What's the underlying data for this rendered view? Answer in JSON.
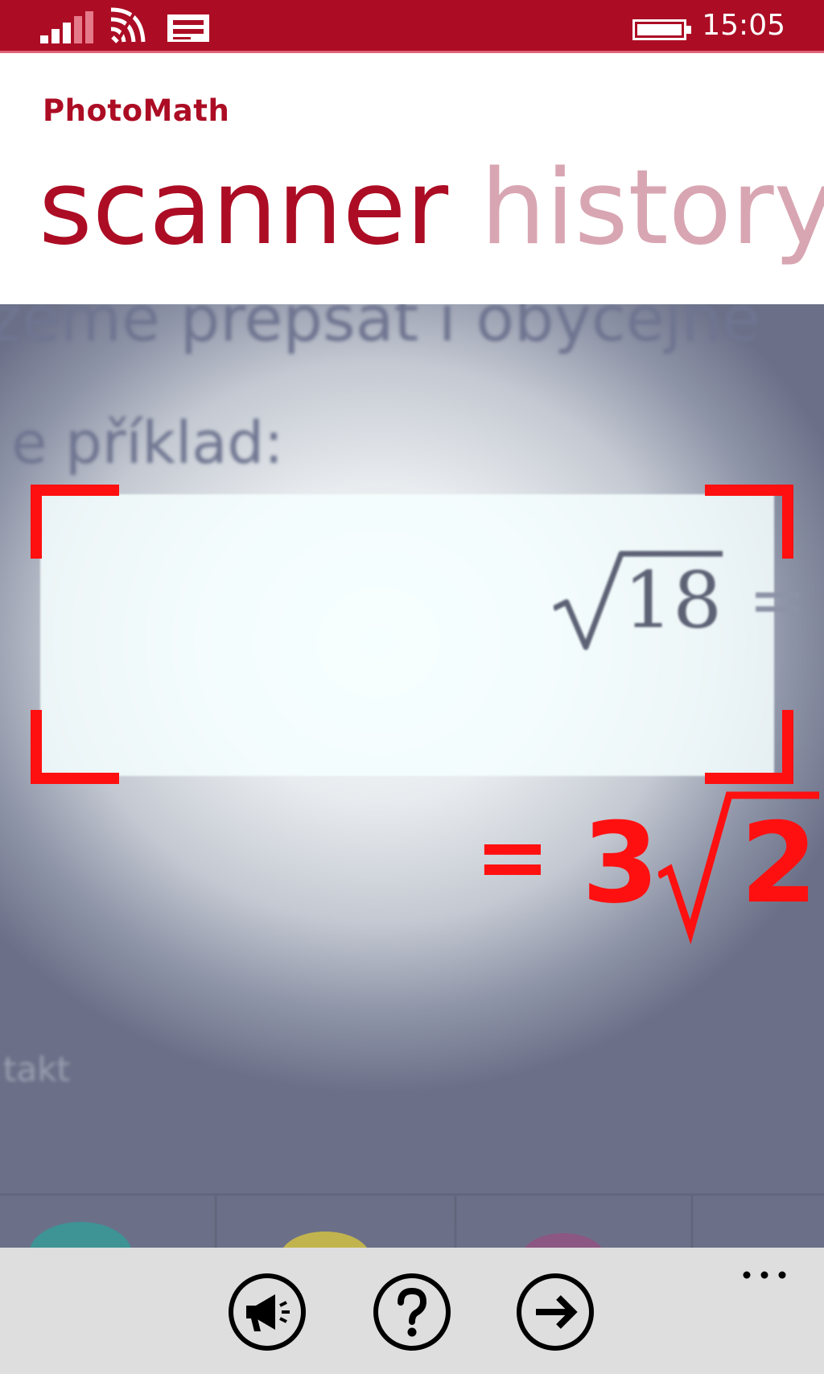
{
  "status_bar": {
    "time": "15:05",
    "icons": [
      "signal-icon",
      "wifi-icon",
      "message-icon",
      "battery-icon"
    ]
  },
  "header": {
    "app_title": "PhotoMath",
    "tabs": [
      {
        "label": "scanner",
        "active": true
      },
      {
        "label": "history",
        "active": false
      }
    ]
  },
  "camera": {
    "background_text": {
      "line1": "zeme přepsat i obyčejně",
      "line2": "e příklad:",
      "line3": "takt"
    },
    "scanned_expression": {
      "radicand": "18",
      "trailing": "="
    },
    "result": {
      "equals": "=",
      "coefficient": "3",
      "radicand": "2"
    },
    "frame_color": "#ff1010"
  },
  "app_bar": {
    "buttons": [
      {
        "name": "feedback",
        "icon": "megaphone-icon"
      },
      {
        "name": "help",
        "icon": "question-icon"
      },
      {
        "name": "next",
        "icon": "arrow-right-icon"
      }
    ],
    "more_icon": "more-dots-icon"
  },
  "colors": {
    "accent": "#ac0d24",
    "accent_light": "#d8a6b2",
    "result_red": "#ff1010",
    "app_bar_bg": "#dedede"
  }
}
